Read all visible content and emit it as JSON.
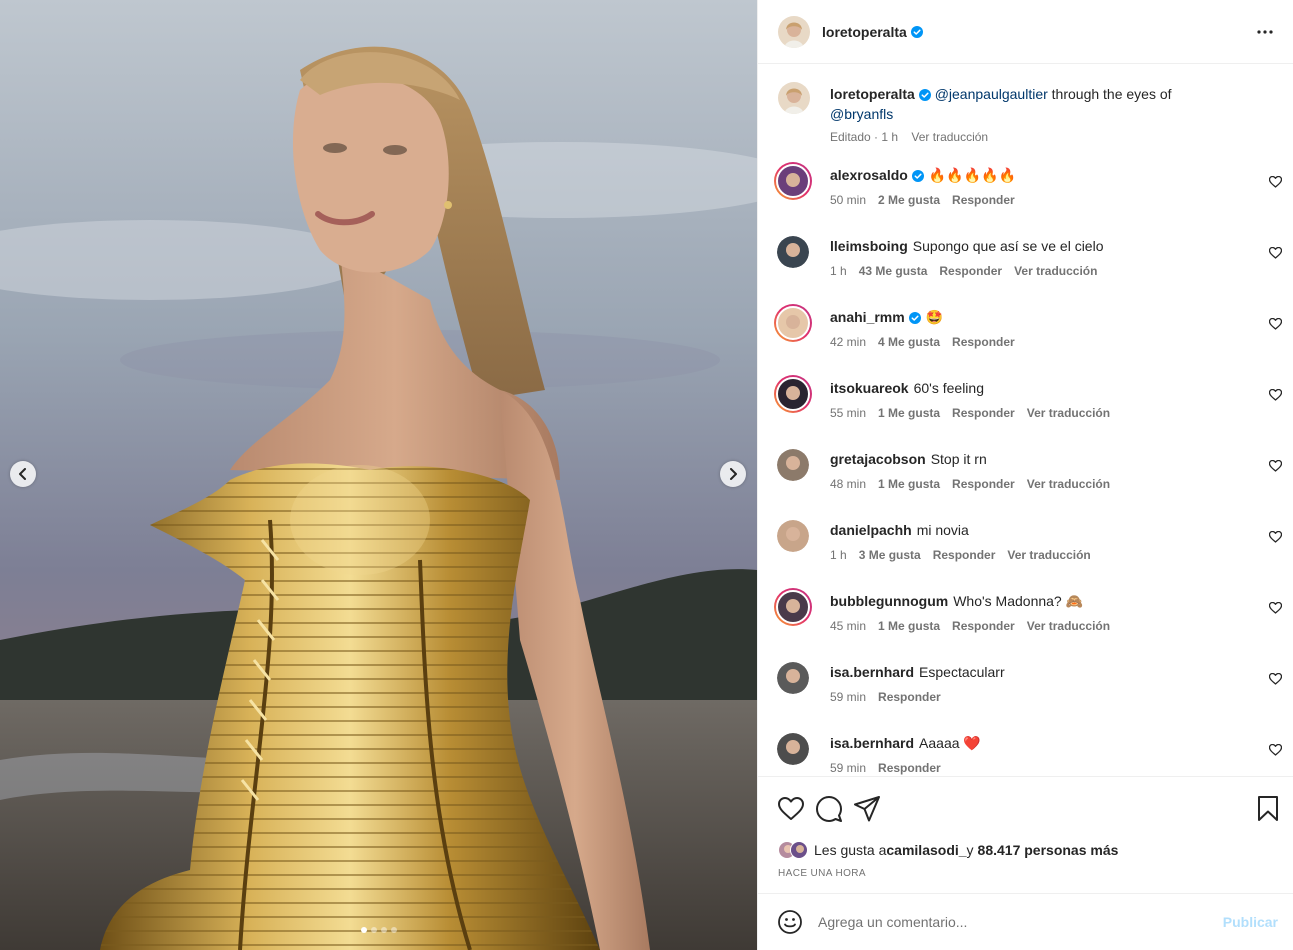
{
  "post": {
    "author": "loretoperalta",
    "more_icon": "more-horizontal-icon",
    "caption": {
      "username": "loretoperalta",
      "mention1": "@jeanpaulgaultier",
      "text": " through the eyes of",
      "mention2": "@bryanfls",
      "edited": "Editado · 1 h",
      "translate": "Ver traducción"
    },
    "carousel": {
      "slide_count": 4,
      "active_index": 0
    }
  },
  "comments": [
    {
      "username": "alexrosaldo",
      "verified": true,
      "text": "🔥🔥🔥🔥🔥",
      "time": "50 min",
      "likes": "2 Me gusta",
      "reply": "Responder",
      "translate": "",
      "story_ring": true
    },
    {
      "username": "lleimsboing",
      "verified": false,
      "text": "Supongo que así se ve el cielo",
      "time": "1 h",
      "likes": "43 Me gusta",
      "reply": "Responder",
      "translate": "Ver traducción",
      "story_ring": false
    },
    {
      "username": "anahi_rmm",
      "verified": true,
      "text": "🤩",
      "time": "42 min",
      "likes": "4 Me gusta",
      "reply": "Responder",
      "translate": "",
      "story_ring": true
    },
    {
      "username": "itsokuareok",
      "verified": false,
      "text": "60's feeling",
      "time": "55 min",
      "likes": "1 Me gusta",
      "reply": "Responder",
      "translate": "Ver traducción",
      "story_ring": true
    },
    {
      "username": "gretajacobson",
      "verified": false,
      "text": "Stop it rn",
      "time": "48 min",
      "likes": "1 Me gusta",
      "reply": "Responder",
      "translate": "Ver traducción",
      "story_ring": false
    },
    {
      "username": "danielpachh",
      "verified": false,
      "text": "mi novia",
      "time": "1 h",
      "likes": "3 Me gusta",
      "reply": "Responder",
      "translate": "Ver traducción",
      "story_ring": false
    },
    {
      "username": "bubblegunnogum",
      "verified": false,
      "text": "Who's Madonna? 🙈",
      "time": "45 min",
      "likes": "1 Me gusta",
      "reply": "Responder",
      "translate": "Ver traducción",
      "story_ring": true
    },
    {
      "username": "isa.bernhard",
      "verified": false,
      "text": "Espectacularr",
      "time": "59 min",
      "likes": "",
      "reply": "Responder",
      "translate": "",
      "story_ring": false
    },
    {
      "username": "isa.bernhard",
      "verified": false,
      "text": "Aaaaa ❤️",
      "time": "59 min",
      "likes": "",
      "reply": "Responder",
      "translate": "",
      "story_ring": false
    }
  ],
  "actions": {
    "icons": [
      "heart-icon",
      "comment-icon",
      "share-icon",
      "bookmark-icon"
    ],
    "likes_prefix": "Les gusta a ",
    "likes_user": "camilasodi_",
    "likes_mid": " y ",
    "likes_count": "88.417 personas más",
    "posted": "HACE UNA HORA"
  },
  "composer": {
    "placeholder": "Agrega un comentario...",
    "publish": "Publicar",
    "emoji_icon": "emoji-icon"
  },
  "colors": {
    "verified": "#0095f6",
    "link": "#00376b",
    "muted": "#737373",
    "publish_disabled": "#b2dffc",
    "liked": "#ed4956"
  }
}
